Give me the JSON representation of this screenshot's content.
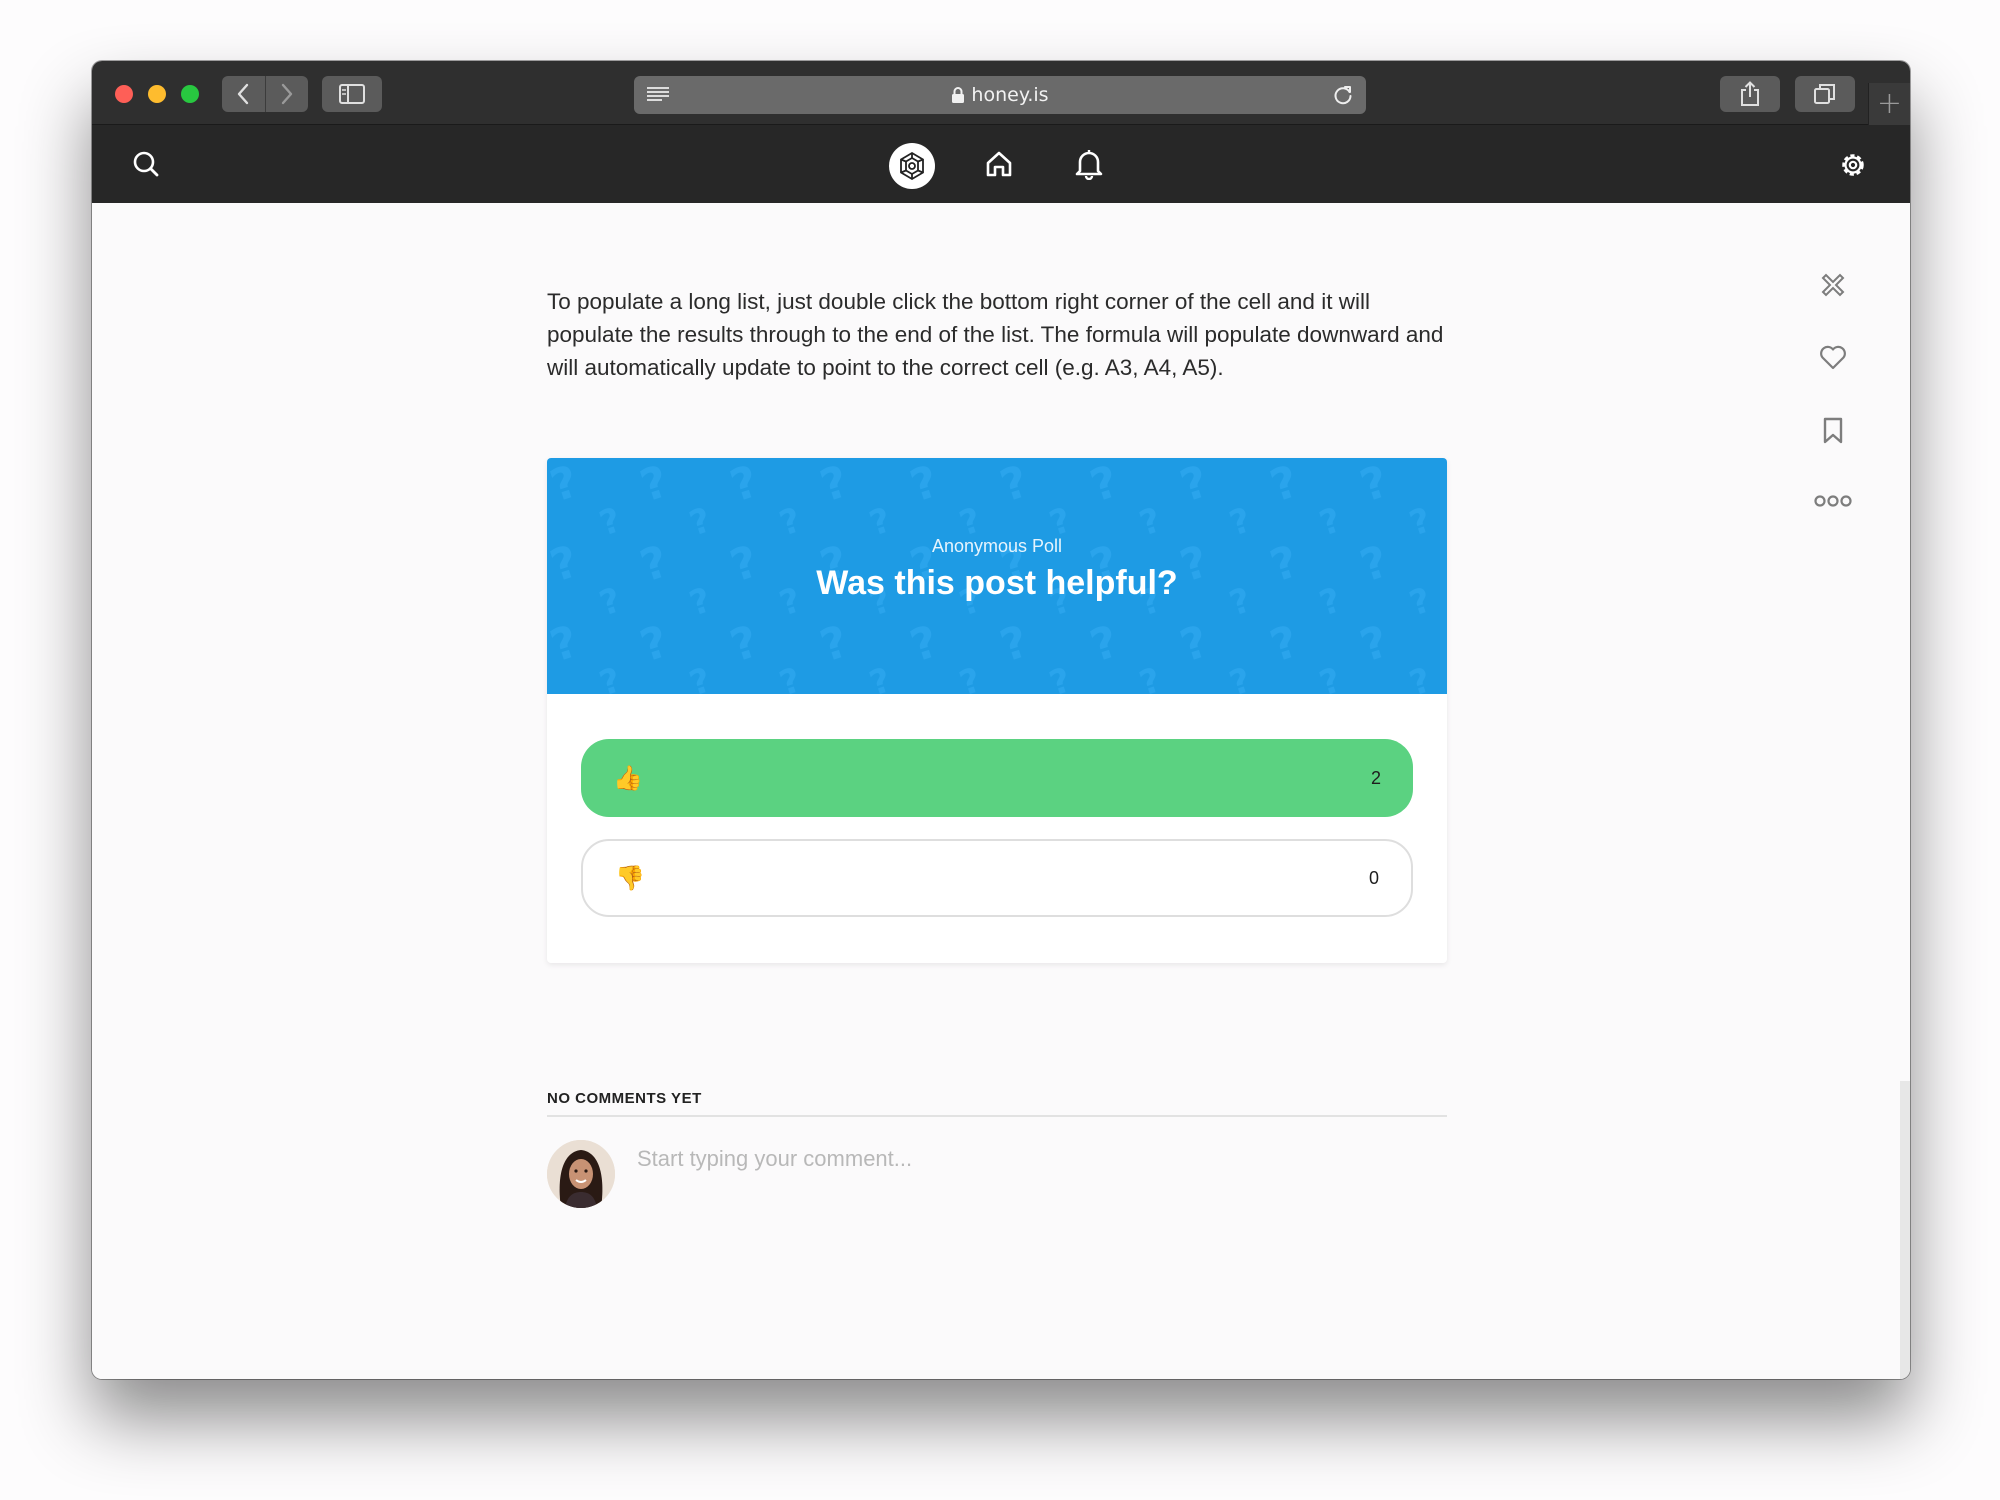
{
  "browser": {
    "url": "honey.is",
    "new_tab_symbol": "+"
  },
  "appbar": {
    "icons": [
      "search-icon",
      "honey-logo-icon",
      "home-icon",
      "bell-icon",
      "settings-icon"
    ]
  },
  "post": {
    "body": "To populate a long list, just double click the bottom right corner of the cell and it will populate the results through to the end of the list. The formula will populate downward and will automatically update to point to the correct cell (e.g. A3, A4, A5)."
  },
  "poll": {
    "subtitle": "Anonymous Poll",
    "title": "Was this post helpful?",
    "options": [
      {
        "emoji": "👍",
        "count": "2"
      },
      {
        "emoji": "👎",
        "count": "0"
      }
    ],
    "colors": {
      "header": "#1e9be4",
      "selected": "#5bd281"
    }
  },
  "comments": {
    "label": "NO COMMENTS YET",
    "placeholder": "Start typing your comment..."
  },
  "side_actions": [
    "close-x-icon",
    "heart-icon",
    "bookmark-icon",
    "more-icon"
  ]
}
